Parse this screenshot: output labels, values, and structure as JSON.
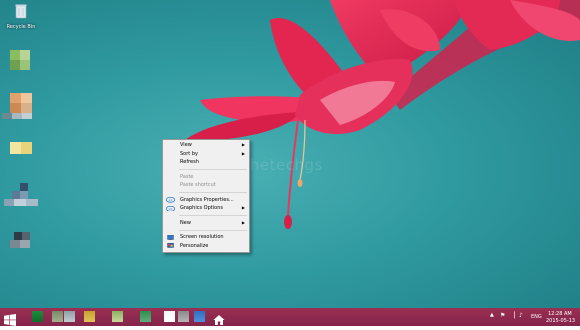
{
  "desktop": {
    "watermark": "@thetechgs",
    "icons": [
      {
        "label": "Recycle Bin"
      }
    ]
  },
  "context_menu": {
    "items": [
      {
        "label": "View",
        "submenu": true,
        "enabled": true
      },
      {
        "label": "Sort by",
        "submenu": true,
        "enabled": true
      },
      {
        "label": "Refresh",
        "enabled": true
      },
      {
        "label": "Paste",
        "enabled": false
      },
      {
        "label": "Paste shortcut",
        "enabled": false
      },
      {
        "label": "Graphics Properties...",
        "enabled": true,
        "icon": "intel-graphics-icon"
      },
      {
        "label": "Graphics Options",
        "submenu": true,
        "enabled": true,
        "icon": "intel-graphics-icon"
      },
      {
        "label": "New",
        "submenu": true,
        "enabled": true
      },
      {
        "label": "Screen resolution",
        "enabled": true,
        "icon": "display-icon"
      },
      {
        "label": "Personalize",
        "enabled": true,
        "icon": "personalize-icon"
      }
    ]
  },
  "taskbar": {
    "language": "ENG",
    "time": "12:28 AM",
    "date": "2015-05-13"
  },
  "colors": {
    "desktop_teal": "#2f9aa0",
    "flower_red": "#e0244f",
    "taskbar": "#8a2a4e"
  }
}
